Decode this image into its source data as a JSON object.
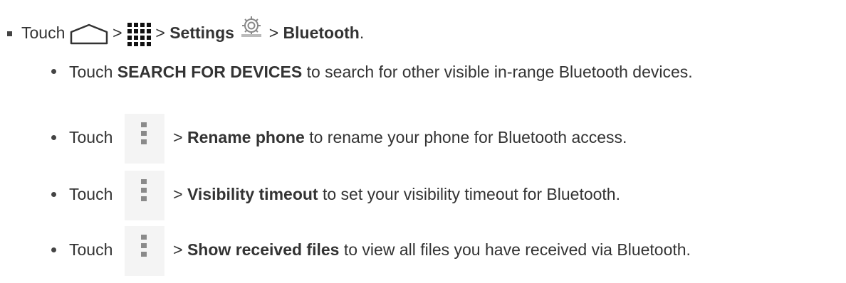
{
  "step": {
    "touch": "Touch",
    "sep": ">",
    "settings": "Settings",
    "bluetooth": "Bluetooth",
    "period": ".",
    "icons": [
      "home-icon",
      "apps-grid-icon",
      "settings-gear-icon"
    ]
  },
  "items": [
    {
      "lead": "Touch",
      "bold": "SEARCH FOR DEVICES",
      "rest": "to search for other visible in-range Bluetooth devices.",
      "has_menu_icon": false
    },
    {
      "lead": "Touch",
      "sep": ">",
      "bold": "Rename phone",
      "rest": "to rename your phone for Bluetooth access.",
      "has_menu_icon": true
    },
    {
      "lead": "Touch",
      "sep": ">",
      "bold": "Visibility timeout",
      "rest": "to set your visibility timeout for Bluetooth.",
      "has_menu_icon": true
    },
    {
      "lead": "Touch",
      "sep": ">",
      "bold": "Show received files",
      "rest": "to view all files you have received via Bluetooth.",
      "has_menu_icon": true
    }
  ]
}
